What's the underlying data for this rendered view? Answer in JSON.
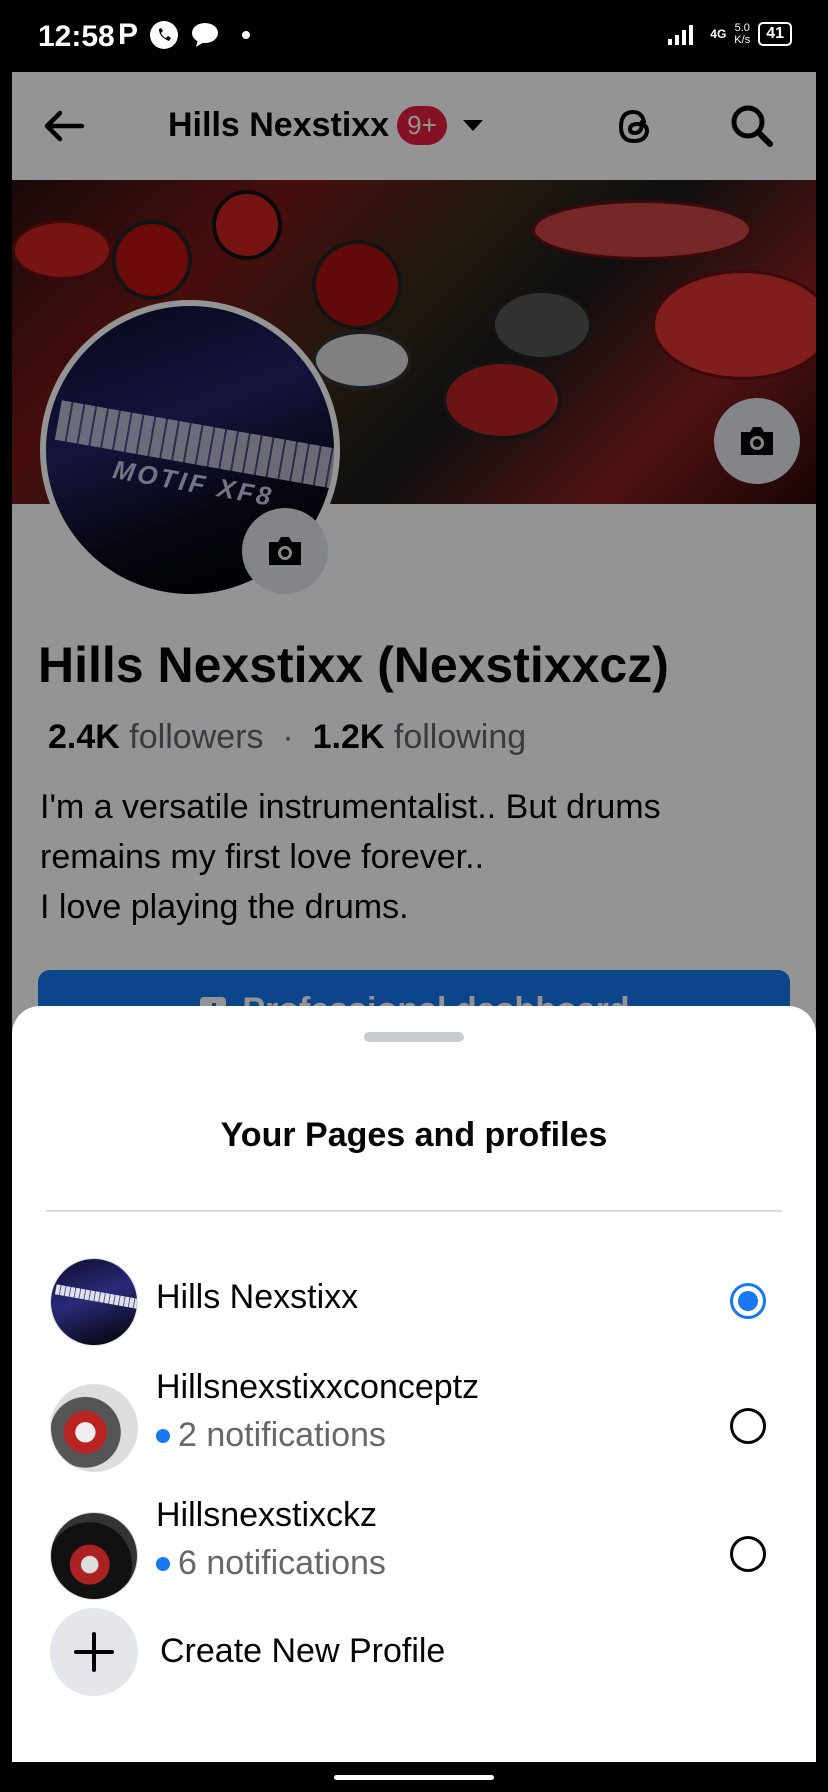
{
  "status_bar": {
    "time": "12:58",
    "notif_letter": "P",
    "network": "4G",
    "speed": "5.0",
    "speed_unit": "K/s",
    "battery": "41"
  },
  "header": {
    "profile_name": "Hills Nexstixx",
    "badge": "9+"
  },
  "avatar_logo": "MOTIF XF8",
  "profile": {
    "full_name": "Hills Nexstixx (Nexstixxcz)",
    "followers_count": "2.4K",
    "followers_label": "followers",
    "separator": "·",
    "following_count": "1.2K",
    "following_label": "following",
    "bio_line1": "I'm a versatile instrumentalist.. But drums",
    "bio_line2": "remains my first love forever..",
    "bio_line3": "I love playing the drums.",
    "dashboard_button": "Professional dashboard"
  },
  "sheet": {
    "title": "Your Pages and profiles",
    "items": [
      {
        "name": "Hills Nexstixx",
        "notifications": "",
        "selected": true
      },
      {
        "name": "Hillsnexstixxconceptz",
        "notifications": "2 notifications",
        "selected": false
      },
      {
        "name": "Hillsnexstixckz",
        "notifications": "6 notifications",
        "selected": false
      }
    ],
    "create_label": "Create New Profile"
  },
  "colors": {
    "accent": "#1877f2",
    "badge": "#e41e3f",
    "text": "#050505",
    "secondary_text": "#65676b"
  }
}
